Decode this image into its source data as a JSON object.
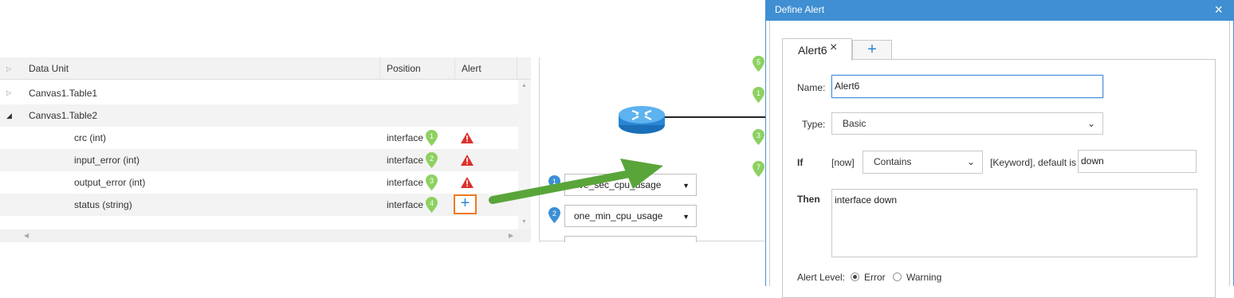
{
  "table": {
    "columns": {
      "data_unit": "Data Unit",
      "position": "Position",
      "alert": "Alert"
    },
    "groups": [
      {
        "label": "Canvas1.Table1",
        "expanded": false
      },
      {
        "label": "Canvas1.Table2",
        "expanded": true
      }
    ],
    "rows": [
      {
        "name": "crc (int)",
        "position": "interface",
        "pin_number": "1",
        "alert": "warning-icon"
      },
      {
        "name": "input_error (int)",
        "position": "interface",
        "pin_number": "2",
        "alert": "warning-icon"
      },
      {
        "name": "output_error (int)",
        "position": "interface",
        "pin_number": "3",
        "alert": "warning-icon"
      },
      {
        "name": "status (string)",
        "position": "interface",
        "pin_number": "4",
        "alert": "+"
      }
    ]
  },
  "canvas": {
    "pins": [
      "5",
      "1",
      "3",
      "7"
    ],
    "dropdowns": [
      {
        "number": "1",
        "value": "five_sec_cpu_usage"
      },
      {
        "number": "2",
        "value": "one_min_cpu_usage"
      }
    ]
  },
  "dialog": {
    "title": "Define Alert",
    "close": "×",
    "tabs": [
      {
        "label": "Alert6",
        "close": "×"
      }
    ],
    "add_tab": "+",
    "name_label": "Name:",
    "name_value": "Alert6",
    "type_label": "Type:",
    "type_value": "Basic",
    "if_label": "If",
    "if_now": "[now]",
    "condition_value": "Contains",
    "keyword_label": "[Keyword], default is",
    "keyword_value": "down",
    "then_label": "Then",
    "then_value": "interface down",
    "alert_level_label": "Alert Level:",
    "levels": [
      {
        "label": "Error",
        "selected": true
      },
      {
        "label": "Warning",
        "selected": false
      }
    ]
  },
  "colors": {
    "titlebar": "#3f8fd2",
    "pin_green": "#8dd160",
    "pin_blue": "#3b8fd6",
    "warning_red": "#d9312b",
    "add_button_border": "#f07a22",
    "arrow_green": "#5aa53a"
  }
}
